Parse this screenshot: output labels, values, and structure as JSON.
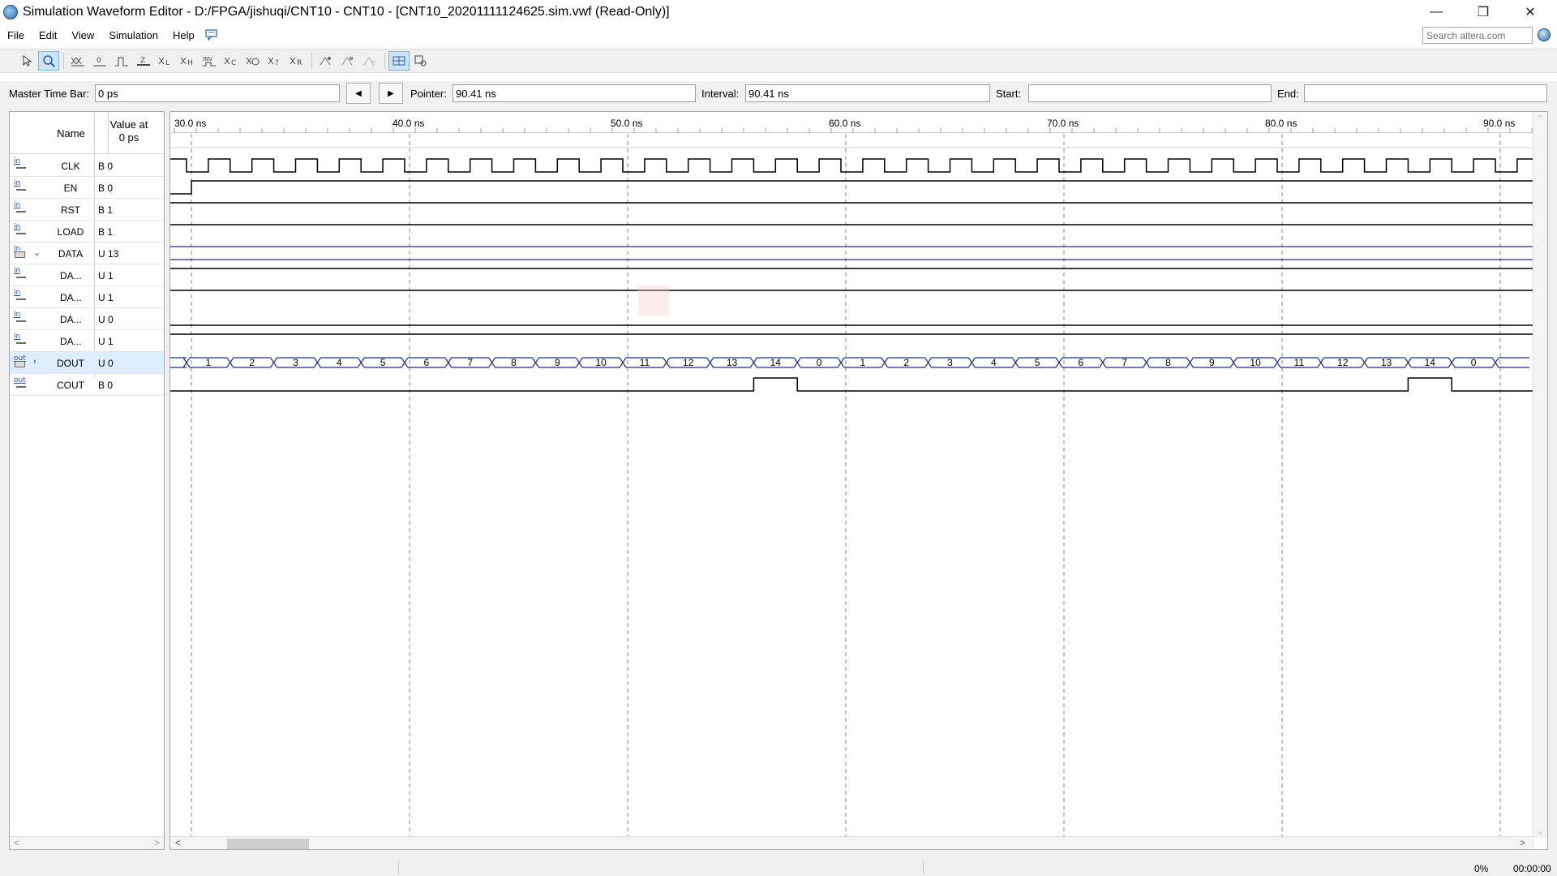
{
  "window": {
    "title": "Simulation Waveform Editor - D:/FPGA/jishuqi/CNT10 - CNT10 - [CNT10_20201111124625.sim.vwf (Read-Only)]",
    "minimize": "—",
    "restore": "❐",
    "close": "✕"
  },
  "menu": {
    "items": [
      "File",
      "Edit",
      "View",
      "Simulation",
      "Help"
    ],
    "search_placeholder": "Search altera.com"
  },
  "toolbar": {
    "icons": [
      "select-arrow-icon",
      "zoom-icon",
      "forcing-unknown-icon",
      "forcing-low-icon",
      "forcing-high-icon",
      "high-impedance-icon",
      "weak-low-icon",
      "weak-high-icon",
      "invert-icon",
      "count-value-icon",
      "clock-icon",
      "arbitrary-value-icon",
      "random-value-icon",
      "overwrite-icon",
      "snap-icon",
      "group-icon",
      "ungroup-icon",
      "grid-icon",
      "settings-icon"
    ]
  },
  "timebar": {
    "master_label": "Master Time Bar:",
    "master_value": "0 ps",
    "pointer_label": "Pointer:",
    "pointer_value": "90.41 ns",
    "interval_label": "Interval:",
    "interval_value": "90.41 ns",
    "start_label": "Start:",
    "start_value": "",
    "end_label": "End:",
    "end_value": "",
    "prev_glyph": "◀",
    "next_glyph": "▶"
  },
  "signals_header": {
    "name": "Name",
    "value_line1": "Value at",
    "value_line2": "0 ps"
  },
  "signals": [
    {
      "io": "in",
      "name": "CLK",
      "value": "B 0",
      "bus": false
    },
    {
      "io": "in",
      "name": "EN",
      "value": "B 0",
      "bus": false
    },
    {
      "io": "in",
      "name": "RST",
      "value": "B 1",
      "bus": false
    },
    {
      "io": "in",
      "name": "LOAD",
      "value": "B 1",
      "bus": false
    },
    {
      "io": "in",
      "name": "DATA",
      "value": "U 13",
      "bus": true,
      "expanded": true
    },
    {
      "io": "in",
      "name": "DA...",
      "value": "U 1",
      "bus": false,
      "child": true
    },
    {
      "io": "in",
      "name": "DA...",
      "value": "U 1",
      "bus": false,
      "child": true
    },
    {
      "io": "in",
      "name": "DA...",
      "value": "U 0",
      "bus": false,
      "child": true
    },
    {
      "io": "in",
      "name": "DA...",
      "value": "U 1",
      "bus": false,
      "child": true
    },
    {
      "io": "out",
      "name": "DOUT",
      "value": "U 0",
      "bus": true,
      "expanded": false,
      "selected": true
    },
    {
      "io": "out",
      "name": "COUT",
      "value": "B 0",
      "bus": false
    }
  ],
  "timescale": {
    "tick_labels": [
      "30.0 ns",
      "40.0 ns",
      "50.0 ns",
      "60.0 ns",
      "70.0 ns",
      "80.0 ns",
      "90.0 ns"
    ]
  },
  "waveforms": {
    "dout_values": [
      "1",
      "2",
      "3",
      "4",
      "5",
      "6",
      "7",
      "8",
      "9",
      "10",
      "11",
      "12",
      "13",
      "14",
      "0",
      "1",
      "2",
      "3",
      "4",
      "5",
      "6",
      "7",
      "8",
      "9",
      "10",
      "11",
      "12",
      "13",
      "14",
      "0"
    ],
    "colors": {
      "line": "#000000",
      "bus": "#1f2b8f"
    }
  },
  "status": {
    "percent": "0%",
    "elapsed": "00:00:00"
  }
}
